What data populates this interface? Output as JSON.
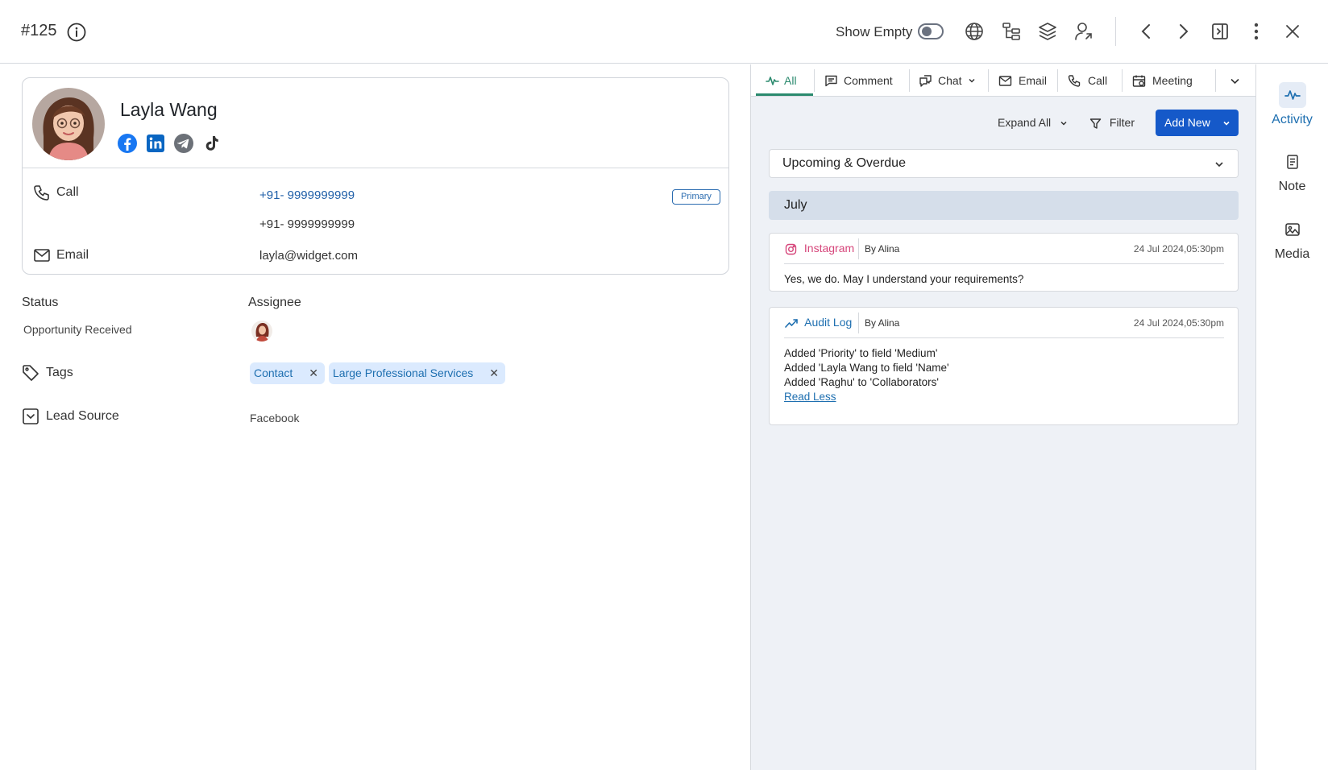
{
  "header": {
    "record_id": "#125",
    "show_empty_label": "Show Empty",
    "show_empty_on": false
  },
  "contact": {
    "name": "Layla Wang",
    "call_label": "Call",
    "phones": [
      "+91- 9999999999",
      "+91- 9999999999"
    ],
    "primary_badge": "Primary",
    "email_label": "Email",
    "email": "layla@widget.com",
    "social_icons": [
      "facebook-icon",
      "linkedin-icon",
      "telegram-icon",
      "tiktok-icon"
    ]
  },
  "fields": {
    "status_label": "Status",
    "status_value": "Opportunity Received",
    "assignee_label": "Assignee",
    "tags_label": "Tags",
    "tags": [
      "Contact",
      "Large Professional Services"
    ],
    "lead_source_label": "Lead Source",
    "lead_source_value": "Facebook"
  },
  "activity": {
    "tabs": [
      "All",
      "Comment",
      "Chat",
      "Email",
      "Call",
      "Meeting"
    ],
    "active_tab": "All",
    "expand_all": "Expand All",
    "filter": "Filter",
    "add_new": "Add New",
    "dropdown": "Upcoming & Overdue",
    "month": "July",
    "items": [
      {
        "source": "Instagram",
        "by": "By Alina",
        "time": "24 Jul 2024,05:30pm",
        "lines": [
          "Yes, we do. May I understand your requirements?"
        ]
      },
      {
        "source": "Audit Log",
        "by": "By Alina",
        "time": "24 Jul 2024,05:30pm",
        "lines": [
          "Added 'Priority' to field 'Medium'",
          "Added 'Layla Wang to field 'Name'",
          "Added 'Raghu' to 'Collaborators'"
        ],
        "link": "Read Less"
      }
    ]
  },
  "rail": {
    "items": [
      "Activity",
      "Note",
      "Media"
    ],
    "active": "Activity"
  },
  "colors": {
    "accent_green": "#2b8a6e",
    "primary_blue": "#1559c9",
    "link_blue": "#1e6fb0",
    "instagram_pink": "#d6457a"
  }
}
